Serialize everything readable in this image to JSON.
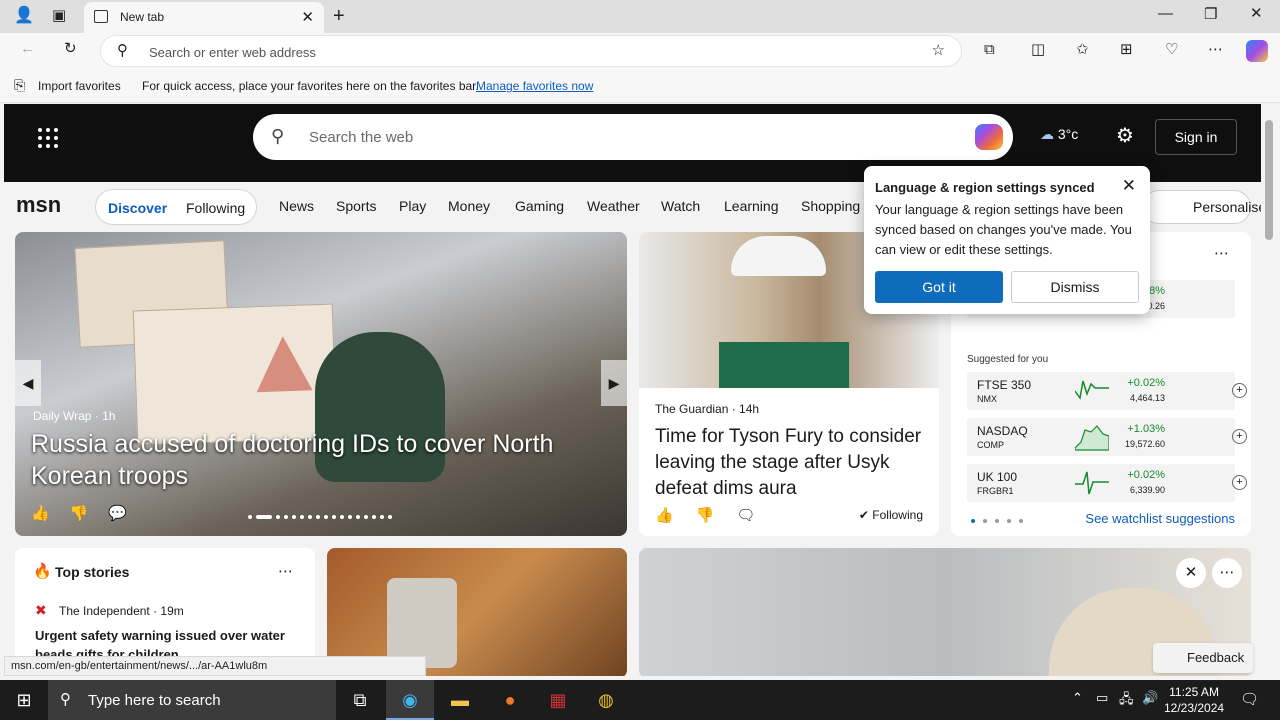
{
  "tab": {
    "title": "New tab"
  },
  "address": {
    "placeholder": "Search or enter web address"
  },
  "favorites_bar": {
    "import": "Import favorites",
    "message": "For quick access, place your favorites here on the favorites bar.",
    "manage_link": "Manage favorites now"
  },
  "msn": {
    "logo": "msn",
    "search_placeholder": "Search the web",
    "weather": "3°c",
    "sign_in": "Sign in",
    "pill": [
      "Discover",
      "Following"
    ],
    "nav": [
      "News",
      "Sports",
      "Play",
      "Money",
      "Gaming",
      "Weather",
      "Watch",
      "Learning",
      "Shopping"
    ],
    "personalise": "Personalise"
  },
  "hero": {
    "source": "Daily Wrap · 1h",
    "headline": "Russia accused of doctoring IDs to cover North Korean troops"
  },
  "fury": {
    "source": "The Guardian · 14h",
    "headline": "Time for Tyson Fury to consider leaving the stage after Usyk defeat dims aura",
    "following": "Following"
  },
  "money": {
    "top_row": {
      "change": "+1.18%",
      "value": "42,840.26"
    },
    "suggested_label": "Suggested for you",
    "rows": [
      {
        "name": "FTSE 350",
        "sym": "NMX",
        "change": "+0.02%",
        "value": "4,464.13"
      },
      {
        "name": "NASDAQ",
        "sym": "COMP",
        "change": "+1.03%",
        "value": "19,572.60"
      },
      {
        "name": "UK 100",
        "sym": "FRGBR1",
        "change": "+0.02%",
        "value": "6,339.90"
      }
    ],
    "watchlist_link": "See watchlist suggestions"
  },
  "top_stories": {
    "heading": "Top stories",
    "source": "The Independent · 19m",
    "headline": "Urgent safety warning issued over water beads gifts for children"
  },
  "popup": {
    "title": "Language & region settings synced",
    "body": "Your language & region settings have been synced based on changes you've made. You can view or edit these settings.",
    "got_it": "Got it",
    "dismiss": "Dismiss"
  },
  "feedback": "Feedback",
  "status_url": "msn.com/en-gb/entertainment/news/.../ar-AA1wlu8m",
  "taskbar": {
    "search_placeholder": "Type here to search",
    "time": "11:25 AM",
    "date": "12/23/2024"
  }
}
